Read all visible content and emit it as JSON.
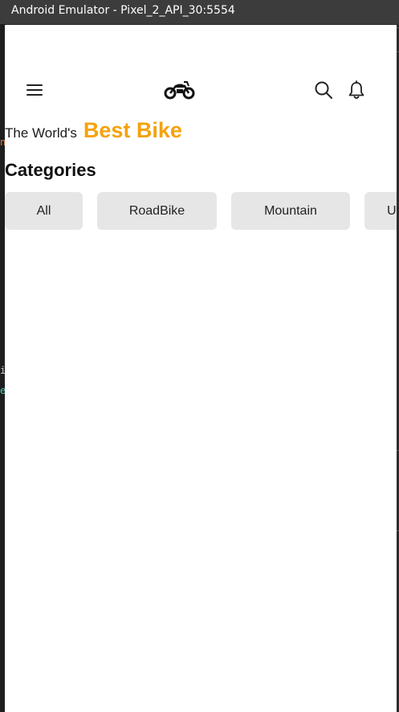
{
  "window": {
    "title": "Android Emulator - Pixel_2_API_30:5554"
  },
  "app": {
    "appbar": {
      "menu_icon": "hamburger-menu-icon",
      "logo_icon": "motorcycle-logo-icon",
      "search_icon": "search-icon",
      "notification_icon": "bell-icon"
    },
    "headline": {
      "prefix": "The World's",
      "highlight": "Best Bike",
      "highlight_color": "#f5a20c"
    },
    "categories": {
      "title": "Categories",
      "items": [
        {
          "label": "All"
        },
        {
          "label": "RoadBike"
        },
        {
          "label": "Mountain"
        },
        {
          "label": "U"
        }
      ]
    }
  },
  "background_editor_fragments": [
    "n",
    "i",
    "e"
  ]
}
